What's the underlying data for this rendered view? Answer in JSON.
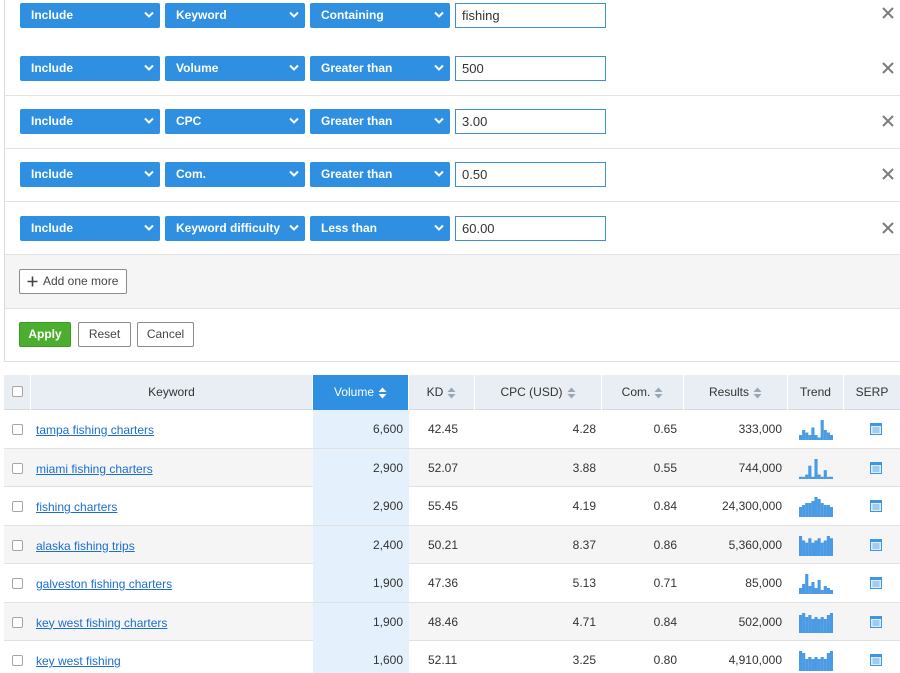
{
  "filters": [
    {
      "mode": "Include",
      "field": "Keyword",
      "op": "Containing",
      "value": "fishing"
    },
    {
      "mode": "Include",
      "field": "Volume",
      "op": "Greater than",
      "value": "500"
    },
    {
      "mode": "Include",
      "field": "CPC",
      "op": "Greater than",
      "value": "3.00"
    },
    {
      "mode": "Include",
      "field": "Com.",
      "op": "Greater than",
      "value": "0.50"
    },
    {
      "mode": "Include",
      "field": "Keyword difficulty",
      "op": "Less than",
      "value": "60.00"
    }
  ],
  "add_more_label": "Add one more",
  "actions": {
    "apply": "Apply",
    "reset": "Reset",
    "cancel": "Cancel"
  },
  "table": {
    "headers": {
      "keyword": "Keyword",
      "volume": "Volume",
      "kd": "KD",
      "cpc": "CPC (USD)",
      "com": "Com.",
      "results": "Results",
      "trend": "Trend",
      "serp": "SERP"
    },
    "rows": [
      {
        "keyword": "tampa fishing charters",
        "volume": "6,600",
        "kd": "42.45",
        "cpc": "4.28",
        "com": "0.65",
        "results": "333,000",
        "trend": [
          2,
          4,
          3,
          2,
          5,
          2,
          1,
          8,
          4,
          3,
          2
        ]
      },
      {
        "keyword": "miami fishing charters",
        "volume": "2,900",
        "kd": "52.07",
        "cpc": "3.88",
        "com": "0.55",
        "results": "744,000",
        "trend": [
          1,
          1,
          2,
          6,
          1,
          9,
          2,
          1,
          4,
          1,
          1
        ]
      },
      {
        "keyword": "fishing charters",
        "volume": "2,900",
        "kd": "55.45",
        "cpc": "4.19",
        "com": "0.84",
        "results": "24,300,000",
        "trend": [
          5,
          6,
          7,
          7,
          8,
          10,
          9,
          7,
          6,
          6,
          5
        ]
      },
      {
        "keyword": "alaska fishing trips",
        "volume": "2,400",
        "kd": "50.21",
        "cpc": "8.37",
        "com": "0.86",
        "results": "5,360,000",
        "trend": [
          9,
          7,
          6,
          8,
          6,
          7,
          8,
          6,
          7,
          9,
          8
        ]
      },
      {
        "keyword": "galveston fishing charters",
        "volume": "1,900",
        "kd": "47.36",
        "cpc": "5.13",
        "com": "0.71",
        "results": "85,000",
        "trend": [
          3,
          5,
          10,
          4,
          6,
          3,
          7,
          2,
          4,
          3,
          2
        ]
      },
      {
        "keyword": "key west fishing charters",
        "volume": "1,900",
        "kd": "48.46",
        "cpc": "4.71",
        "com": "0.84",
        "results": "502,000",
        "trend": [
          9,
          10,
          8,
          9,
          7,
          8,
          7,
          8,
          7,
          9,
          10
        ]
      },
      {
        "keyword": "key west fishing",
        "volume": "1,600",
        "kd": "52.11",
        "cpc": "3.25",
        "com": "0.80",
        "results": "4,910,000",
        "trend": [
          10,
          9,
          6,
          7,
          6,
          7,
          6,
          7,
          6,
          9,
          10
        ]
      }
    ]
  },
  "colors": {
    "accent": "#2f8fe0",
    "apply": "#4cae2e",
    "link": "#1a6ed0",
    "trend": "#4a9be3"
  }
}
